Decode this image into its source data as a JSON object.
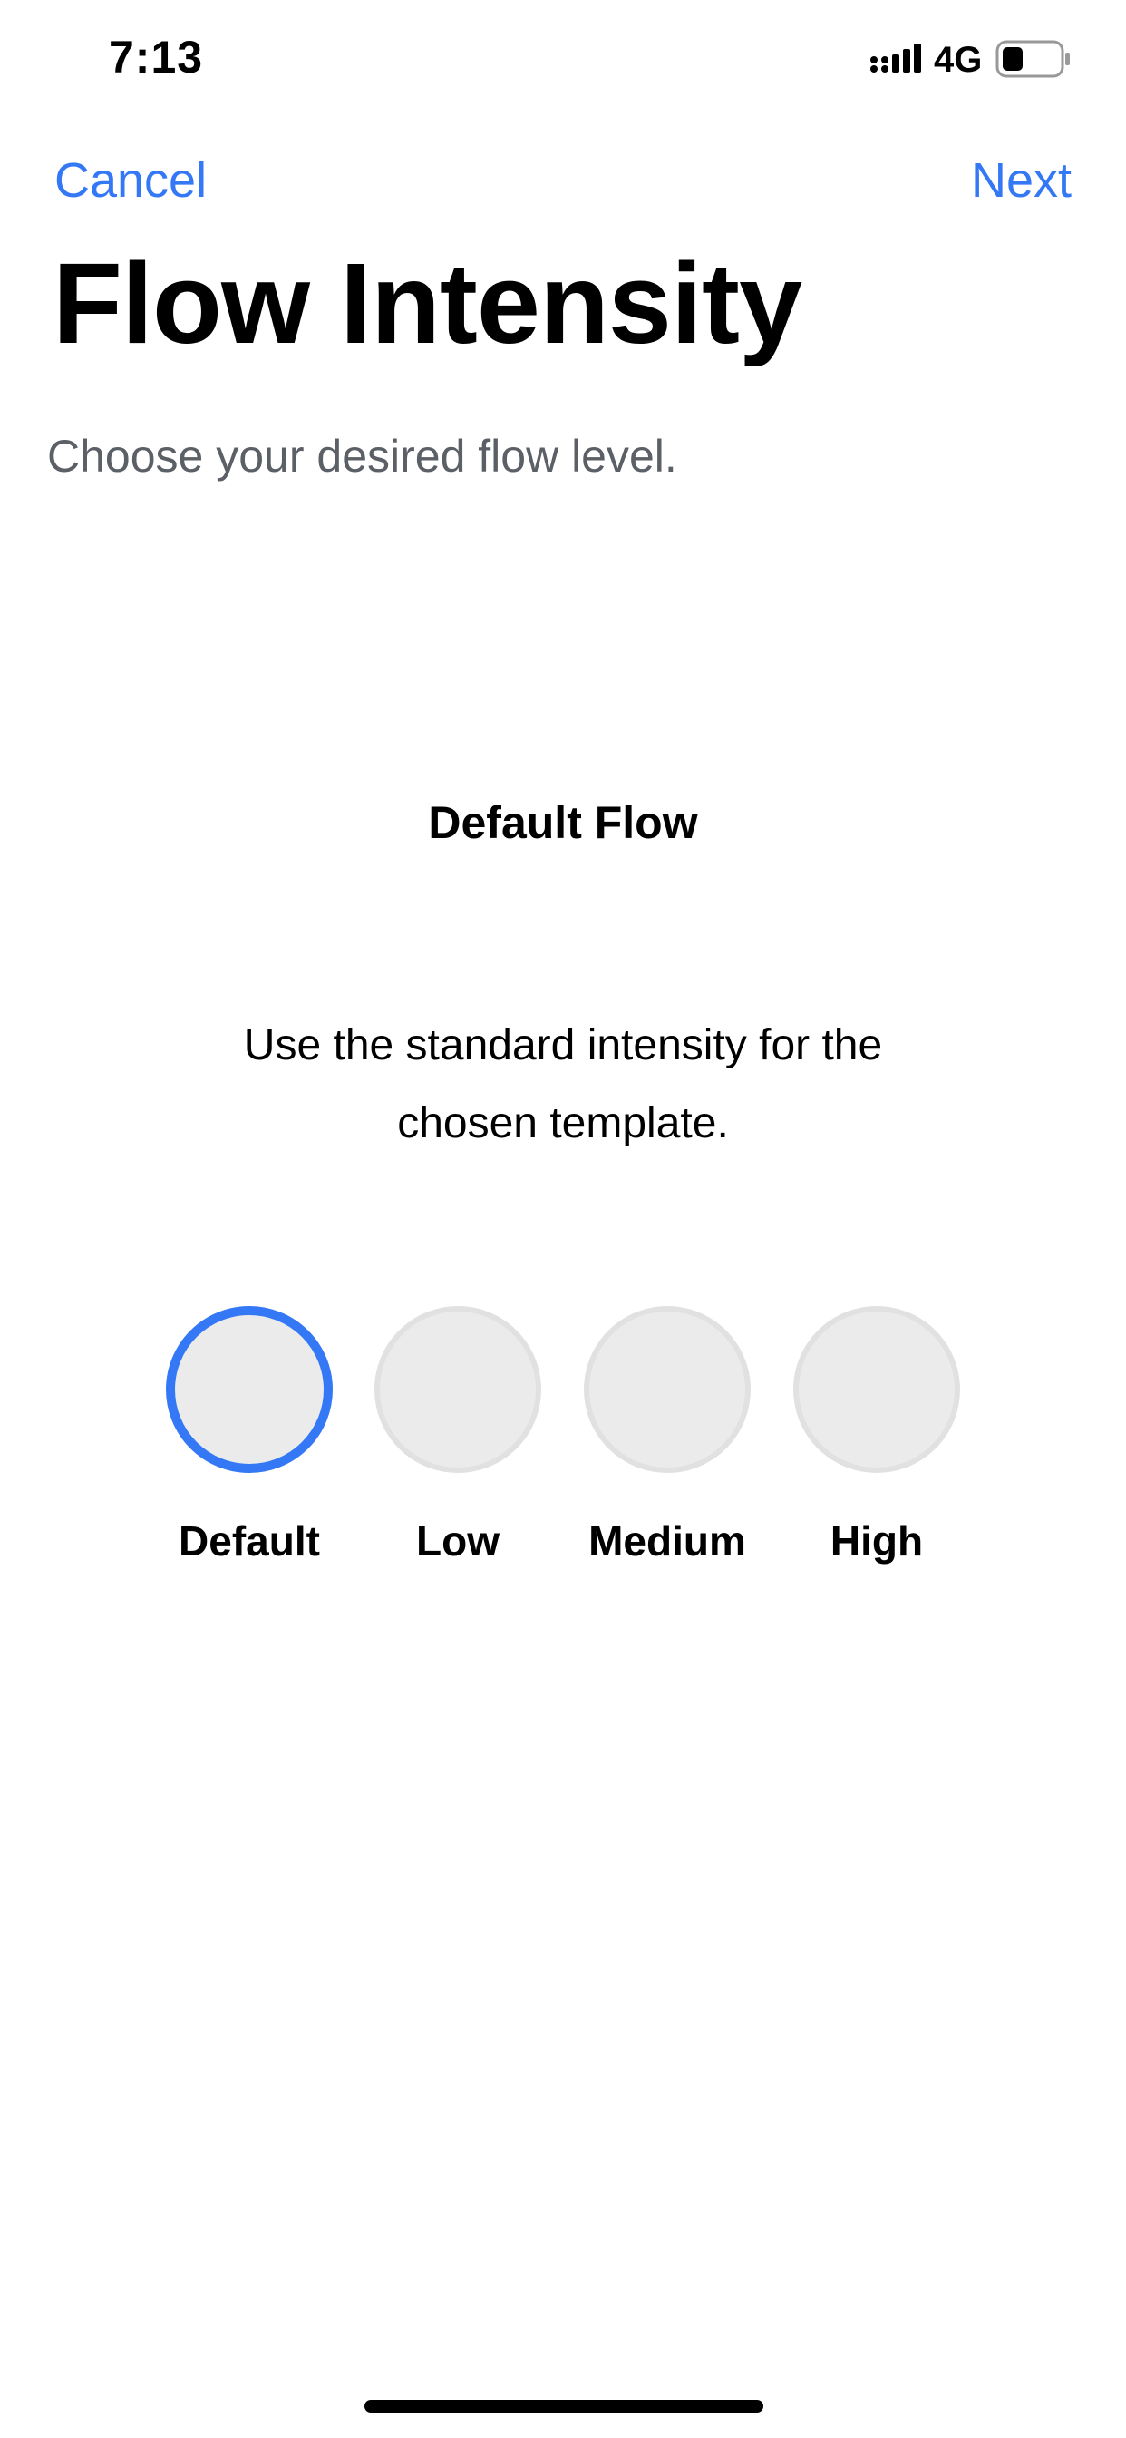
{
  "status_bar": {
    "time": "7:13",
    "network": "4G",
    "icons": [
      "signal-icon",
      "battery-icon"
    ]
  },
  "nav": {
    "cancel_label": "Cancel",
    "next_label": "Next"
  },
  "header": {
    "title": "Flow Intensity",
    "subtitle": "Choose your desired flow level."
  },
  "selection": {
    "heading": "Default Flow",
    "description": "Use the standard intensity for the chosen template."
  },
  "options": [
    {
      "label": "Default",
      "selected": true
    },
    {
      "label": "Low",
      "selected": false
    },
    {
      "label": "Medium",
      "selected": false
    },
    {
      "label": "High",
      "selected": false
    }
  ],
  "colors": {
    "accent": "#3478f6",
    "option_fill": "#ebebeb",
    "option_border": "#e1e1e1",
    "subtitle_text": "#5b5f66"
  }
}
